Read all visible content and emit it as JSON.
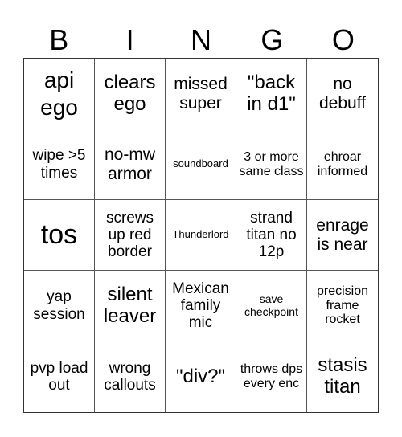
{
  "header": [
    "B",
    "I",
    "N",
    "G",
    "O"
  ],
  "cells": [
    {
      "text": "api ego",
      "size": "s-l"
    },
    {
      "text": "clears ego",
      "size": "s-ml"
    },
    {
      "text": "missed super",
      "size": "s-m"
    },
    {
      "text": "\"back in d1\"",
      "size": "s-ml"
    },
    {
      "text": "no debuff",
      "size": "s-m"
    },
    {
      "text": "wipe >5 times",
      "size": "s-sm"
    },
    {
      "text": "no-mw armor",
      "size": "s-m"
    },
    {
      "text": "soundboard",
      "size": "s-xxs"
    },
    {
      "text": "3 or more same class",
      "size": "s-s"
    },
    {
      "text": "ehroar informed",
      "size": "s-s"
    },
    {
      "text": "tos",
      "size": "s-xl"
    },
    {
      "text": "screws up red border",
      "size": "s-sm"
    },
    {
      "text": "Thunderlord",
      "size": "s-xxs"
    },
    {
      "text": "strand titan no 12p",
      "size": "s-sm"
    },
    {
      "text": "enrage is near",
      "size": "s-m"
    },
    {
      "text": "yap session",
      "size": "s-sm"
    },
    {
      "text": "silent leaver",
      "size": "s-ml"
    },
    {
      "text": "Mexican family mic",
      "size": "s-sm"
    },
    {
      "text": "save checkpoint",
      "size": "s-xs"
    },
    {
      "text": "precision frame rocket",
      "size": "s-s"
    },
    {
      "text": "pvp load out",
      "size": "s-sm"
    },
    {
      "text": "wrong callouts",
      "size": "s-sm"
    },
    {
      "text": "\"div?\"",
      "size": "s-ml"
    },
    {
      "text": "throws dps every enc",
      "size": "s-s"
    },
    {
      "text": "stasis titan",
      "size": "s-ml"
    }
  ]
}
